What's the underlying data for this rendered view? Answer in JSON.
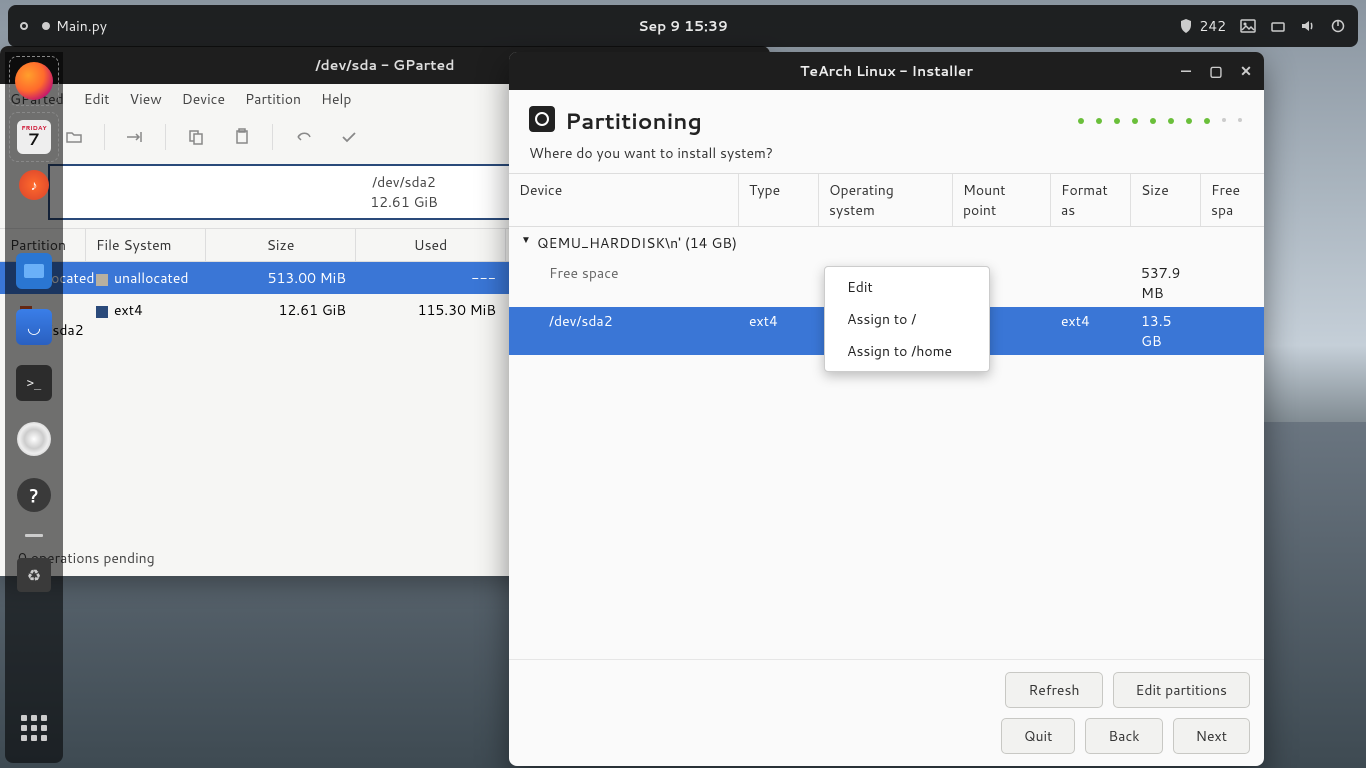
{
  "topbar": {
    "app_label": "Main.py",
    "datetime": "Sep 9  15:39",
    "badge": "242"
  },
  "dock": {
    "items": [
      "firefox",
      "calendar",
      "music",
      "files",
      "software",
      "terminal",
      "disc",
      "help",
      "dash",
      "trash",
      "apps"
    ],
    "calendar": {
      "dow": "FRIDAY",
      "day": "7"
    }
  },
  "gparted": {
    "title": "/dev/sda - GParted",
    "menu": [
      "GParted",
      "Edit",
      "View",
      "Device",
      "Partition",
      "Help"
    ],
    "disk": {
      "name": "/dev/sda2",
      "size": "12.61 GiB"
    },
    "columns": [
      "Partition",
      "File System",
      "Size",
      "Used"
    ],
    "rows": [
      {
        "part": "unallocated",
        "fs": "unallocated",
        "size": "513.00 MiB",
        "used": "---",
        "swatch": "#b8b0a0",
        "selected": true
      },
      {
        "part": "/dev/sda2",
        "fs": "ext4",
        "size": "12.61 GiB",
        "used": "115.30 MiB",
        "swatch": "#2a4a7a",
        "selected": false
      }
    ],
    "status": "0 operations pending"
  },
  "installer": {
    "title": "TeArch Linux - Installer",
    "heading": "Partitioning",
    "subtitle": "Where do you want to install system?",
    "columns": [
      "Device",
      "Type",
      "Operating system",
      "Mount point",
      "Format as",
      "Size",
      "Free spa"
    ],
    "disk_label": "QEMU_HARDDISK\\n' (14 GB)",
    "rows": [
      {
        "device": "Free space",
        "type": "",
        "os": "",
        "mnt": "",
        "fmt": "",
        "size": "537.9 MB",
        "selected": false,
        "indent": true,
        "muted": true
      },
      {
        "device": "/dev/sda2",
        "type": "ext4",
        "os": "",
        "mnt": "",
        "fmt": "ext4",
        "size": "13.5 GB",
        "selected": true,
        "indent": true
      }
    ],
    "context_menu": [
      "Edit",
      "Assign to /",
      "Assign to /home"
    ],
    "buttons_row1": [
      "Refresh",
      "Edit partitions"
    ],
    "buttons_row2": [
      "Quit",
      "Back",
      "Next"
    ]
  }
}
